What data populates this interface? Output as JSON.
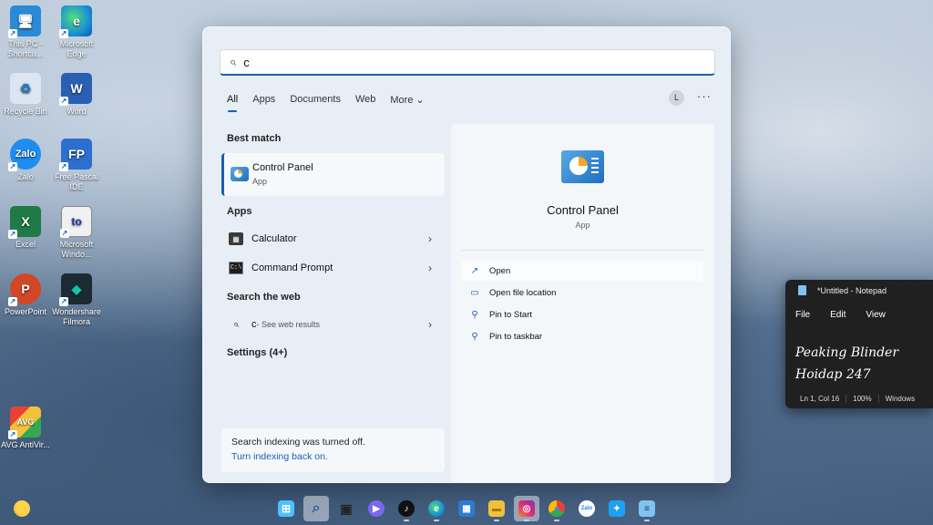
{
  "desktop": {
    "icons": [
      {
        "label": "This PC - Shortcu...",
        "glyph": "🖥",
        "color": "#2b8ad6"
      },
      {
        "label": "Microsoft Edge",
        "glyph": "e",
        "color": "#1c8fd6"
      },
      {
        "label": "Recycle Bin",
        "glyph": "♻",
        "color": "#b9cbe0"
      },
      {
        "label": "Word",
        "glyph": "W",
        "color": "#2b5fb4"
      },
      {
        "label": "Zalo",
        "glyph": "Zalo",
        "color": "#1f8cf0"
      },
      {
        "label": "Free Pascal IDE",
        "glyph": "FP",
        "color": "#2c6fd0"
      },
      {
        "label": "Excel",
        "glyph": "X",
        "color": "#1f7a46"
      },
      {
        "label": "Microsoft Windo...",
        "glyph": "to",
        "color": "#e8e8e8"
      },
      {
        "label": "PowerPoint",
        "glyph": "P",
        "color": "#d24726"
      },
      {
        "label": "Wondershare Filmora",
        "glyph": "◆",
        "color": "#15c3a8"
      },
      {
        "label": "AVG AntiVir...",
        "glyph": "AVG",
        "color": "#e0582a"
      }
    ]
  },
  "search": {
    "query": "c",
    "tabs": [
      "All",
      "Apps",
      "Documents",
      "Web",
      "More ⌄"
    ],
    "avatar_initial": "L",
    "more_options": "···"
  },
  "results": {
    "best_match_header": "Best match",
    "best_match": {
      "name": "Control Panel",
      "type": "App"
    },
    "apps_header": "Apps",
    "apps": [
      {
        "name": "Calculator",
        "icon": "calculator-icon"
      },
      {
        "name": "Command Prompt",
        "icon": "command-prompt-icon"
      }
    ],
    "web_header": "Search the web",
    "web_query": "c",
    "web_hint": " - See web results",
    "settings_header": "Settings (4+)",
    "indexing_notice": "Search indexing was turned off.",
    "indexing_link": "Turn indexing back on."
  },
  "detail": {
    "title": "Control Panel",
    "type": "App",
    "actions": [
      {
        "label": "Open",
        "icon": "open-icon"
      },
      {
        "label": "Open file location",
        "icon": "folder-icon"
      },
      {
        "label": "Pin to Start",
        "icon": "pin-icon"
      },
      {
        "label": "Pin to taskbar",
        "icon": "pin-icon"
      }
    ]
  },
  "notepad": {
    "title": "*Untitled - Notepad",
    "menu": [
      "File",
      "Edit",
      "View"
    ],
    "line1": "Peaking Blinder",
    "line2": "Hoidap 247",
    "status_position": "Ln 1, Col 16",
    "status_zoom": "100%",
    "status_eol": "Windows"
  },
  "taskbar": {
    "items": [
      {
        "name": "start",
        "glyph": "⊞",
        "color": "#4cc2ff"
      },
      {
        "name": "search",
        "glyph": "⌕",
        "color": "#1a5fb4"
      },
      {
        "name": "task-view",
        "glyph": "▣",
        "color": "#333"
      },
      {
        "name": "teams-chat",
        "glyph": "●",
        "color": "#7b68ee"
      },
      {
        "name": "tiktok",
        "glyph": "♪",
        "color": "#111"
      },
      {
        "name": "edge",
        "glyph": "e",
        "color": "#1c8fd6"
      },
      {
        "name": "store",
        "glyph": "▦",
        "color": "#2b7cd3"
      },
      {
        "name": "file-explorer",
        "glyph": "▬",
        "color": "#f2c13a"
      },
      {
        "name": "instagram",
        "glyph": "◎",
        "color": "#d6249f"
      },
      {
        "name": "chrome",
        "glyph": "●",
        "color": "#e94235"
      },
      {
        "name": "zalo",
        "glyph": "Zalo",
        "color": "#1f8cf0"
      },
      {
        "name": "twitter",
        "glyph": "✦",
        "color": "#1da1f2"
      },
      {
        "name": "notepad",
        "glyph": "≡",
        "color": "#7fc3f2"
      }
    ]
  }
}
